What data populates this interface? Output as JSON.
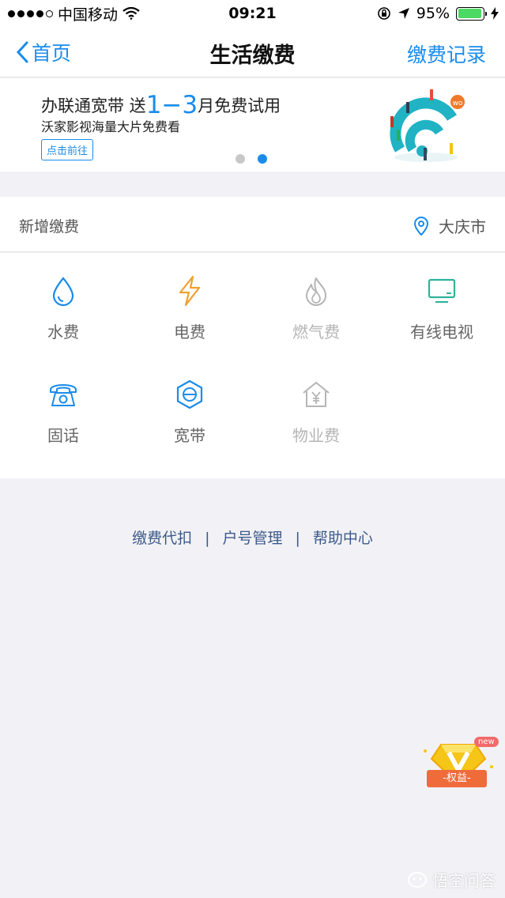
{
  "status_bar": {
    "carrier": "中国移动",
    "time": "09:21",
    "battery": "95%",
    "battery_level": 0.95
  },
  "nav": {
    "back_label": "首页",
    "title": "生活缴费",
    "right_label": "缴费记录"
  },
  "banner": {
    "line1_pre": "办联通宽带  送",
    "line1_big": "1−3",
    "line1_post": "月免费试用",
    "line2": "沃家影视海量大片免费看",
    "button": "点击前往",
    "slides": 2,
    "active_slide": 2
  },
  "section": {
    "title": "新增缴费",
    "city": "大庆市"
  },
  "services": [
    {
      "label": "水费",
      "icon": "water-drop-icon",
      "enabled": true
    },
    {
      "label": "电费",
      "icon": "lightning-icon",
      "enabled": true
    },
    {
      "label": "燃气费",
      "icon": "flame-icon",
      "enabled": false
    },
    {
      "label": "有线电视",
      "icon": "tv-icon",
      "enabled": true
    },
    {
      "label": "固话",
      "icon": "telephone-icon",
      "enabled": true
    },
    {
      "label": "宽带",
      "icon": "broadband-icon",
      "enabled": true
    },
    {
      "label": "物业费",
      "icon": "house-yen-icon",
      "enabled": false
    }
  ],
  "footer": {
    "link1": "缴费代扣",
    "link2": "户号管理",
    "link3": "帮助中心",
    "separator": "|"
  },
  "badge": {
    "new": "new",
    "label": "-权益-"
  },
  "watermark": "悟空问答",
  "colors": {
    "accent": "#1a8cec",
    "electric": "#f0a030",
    "tv": "#2fb39a",
    "disabled": "#b5b5b5"
  }
}
